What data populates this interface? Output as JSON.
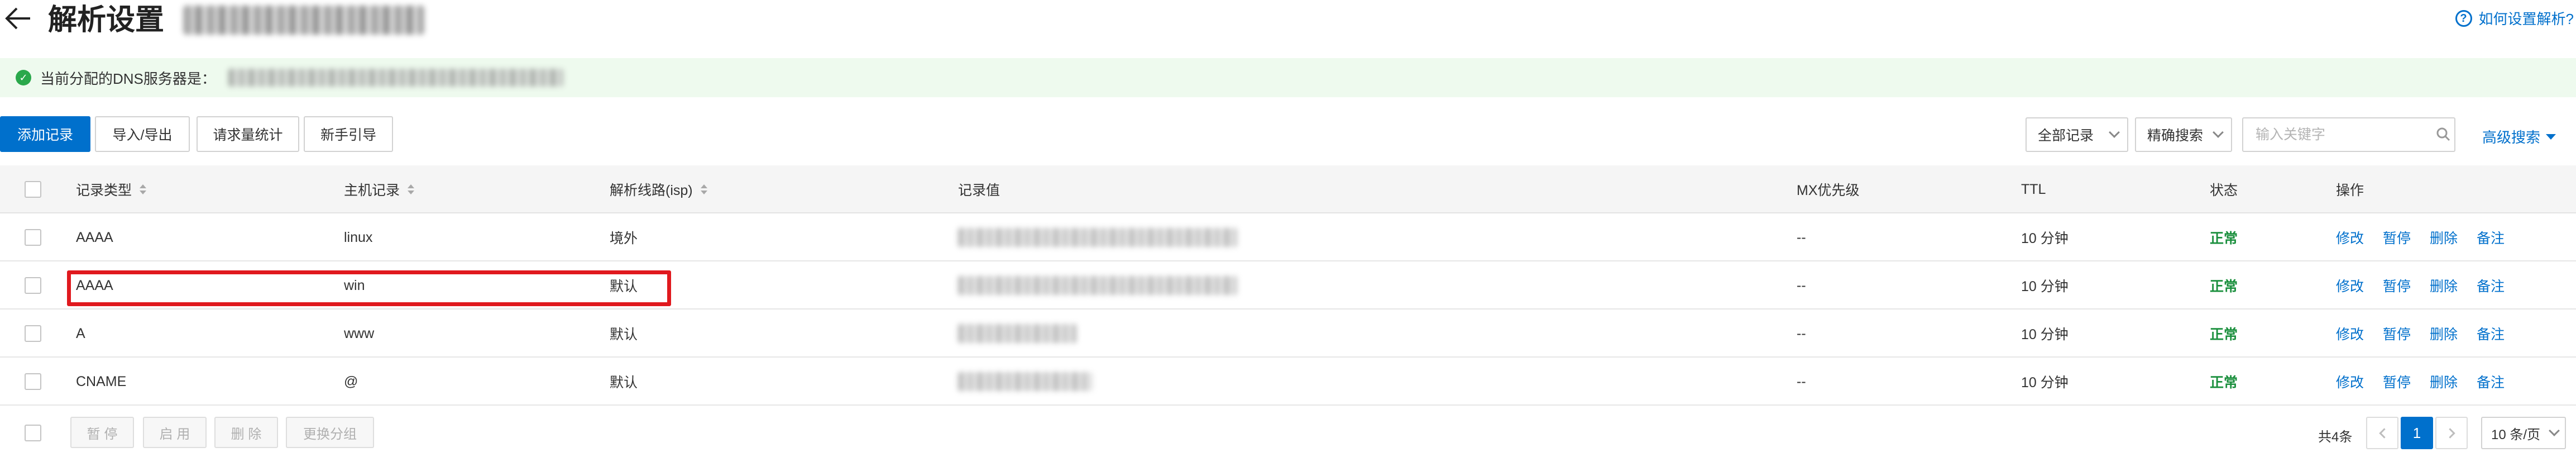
{
  "header": {
    "title": "解析设置",
    "help_link": "如何设置解析?",
    "help_icon": "question-circle-icon"
  },
  "dns_notice": {
    "label": "当前分配的DNS服务器是：",
    "status_icon": "check-circle-icon",
    "status_color": "#2aa84b"
  },
  "toolbar": {
    "add_record": "添加记录",
    "import_export": "导入/导出",
    "request_stats": "请求量统计",
    "beginner_guide": "新手引导",
    "record_filter": "全部记录",
    "match_mode": "精确搜索",
    "search_placeholder": "输入关键字",
    "advanced_search": "高级搜索"
  },
  "table": {
    "columns": [
      "记录类型",
      "主机记录",
      "解析线路(isp)",
      "记录值",
      "MX优先级",
      "TTL",
      "状态",
      "操作"
    ],
    "rows": [
      {
        "type": "AAAA",
        "host": "linux",
        "line": "境外",
        "mx": "--",
        "ttl": "10 分钟",
        "status": "正常"
      },
      {
        "type": "AAAA",
        "host": "win",
        "line": "默认",
        "mx": "--",
        "ttl": "10 分钟",
        "status": "正常"
      },
      {
        "type": "A",
        "host": "www",
        "line": "默认",
        "mx": "--",
        "ttl": "10 分钟",
        "status": "正常"
      },
      {
        "type": "CNAME",
        "host": "@",
        "line": "默认",
        "mx": "--",
        "ttl": "10 分钟",
        "status": "正常"
      }
    ],
    "actions": [
      "修改",
      "暂停",
      "删除",
      "备注"
    ],
    "status_color": "#1a8f3d",
    "highlighted_row": 1,
    "highlight_color": "#e0191e"
  },
  "footer": {
    "batch_pause": "暂 停",
    "batch_enable": "启 用",
    "batch_delete": "删 除",
    "batch_regroup": "更换分组",
    "total": "共4条",
    "current_page": "1",
    "page_size": "10 条/页"
  },
  "colors": {
    "accent": "#0070cc",
    "notice_background": "#eefaee"
  }
}
